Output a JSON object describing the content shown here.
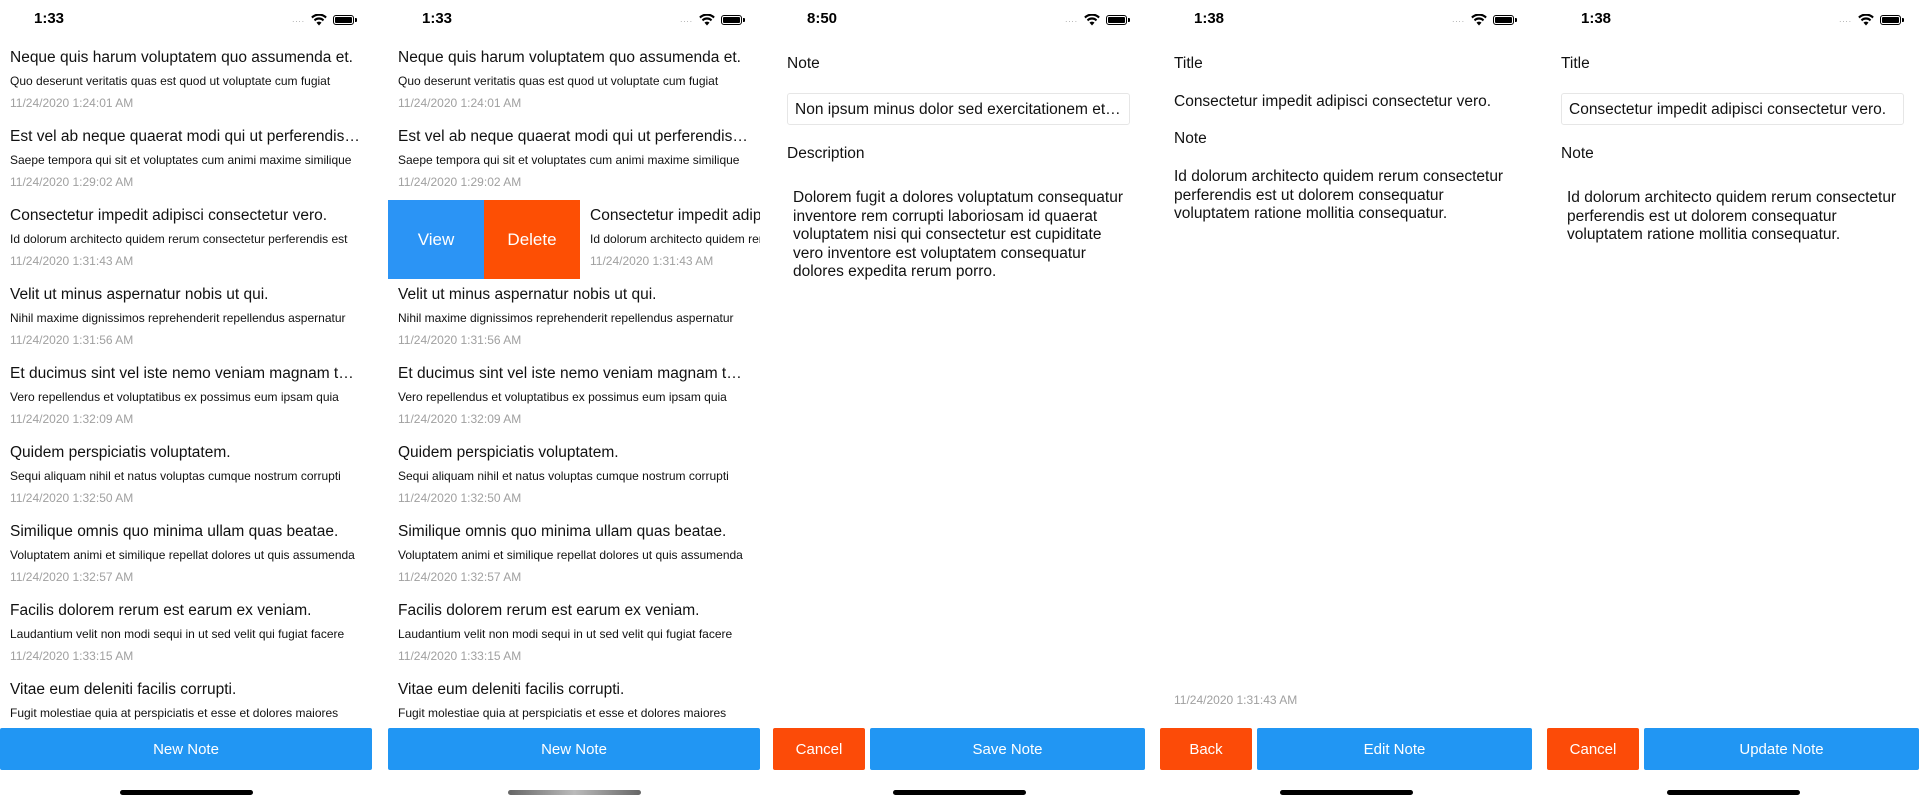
{
  "screens": [
    {
      "time": "1:33"
    },
    {
      "time": "1:33"
    },
    {
      "time": "8:50"
    },
    {
      "time": "1:38"
    },
    {
      "time": "1:38"
    }
  ],
  "notes": [
    {
      "title": "Neque quis harum voluptatem quo assumenda et.",
      "description": "Quo deserunt veritatis quas est quod ut voluptate cum fugiat",
      "timestamp": "11/24/2020 1:24:01 AM"
    },
    {
      "title": "Est vel ab neque quaerat modi qui ut perferendis illo.",
      "description": "Saepe tempora qui sit et voluptates cum animi maxime similique",
      "timestamp": "11/24/2020 1:29:02 AM"
    },
    {
      "title": "Consectetur impedit adipisci consectetur vero.",
      "description": "Id dolorum architecto quidem rerum consectetur perferendis est",
      "timestamp": "11/24/2020 1:31:43 AM"
    },
    {
      "title": "Velit ut minus aspernatur nobis ut qui.",
      "description": "Nihil maxime dignissimos reprehenderit repellendus aspernatur",
      "timestamp": "11/24/2020 1:31:56 AM"
    },
    {
      "title": "Et ducimus sint vel iste nemo veniam magnam tempore.",
      "description": "Vero repellendus et voluptatibus ex possimus eum ipsam quia",
      "timestamp": "11/24/2020 1:32:09 AM"
    },
    {
      "title": "Quidem perspiciatis voluptatem.",
      "description": "Sequi aliquam nihil et natus voluptas cumque nostrum corrupti",
      "timestamp": "11/24/2020 1:32:50 AM"
    },
    {
      "title": "Similique omnis quo minima ullam quas beatae.",
      "description": "Voluptatem animi et similique repellat dolores ut quis assumenda",
      "timestamp": "11/24/2020 1:32:57 AM"
    },
    {
      "title": "Facilis dolorem rerum est earum ex veniam.",
      "description": "Laudantium velit non modi sequi in ut sed velit qui fugiat facere",
      "timestamp": "11/24/2020 1:33:15 AM"
    },
    {
      "title": "Vitae eum deleniti facilis corrupti.",
      "description": "Fugit molestiae quia at perspiciatis et esse et dolores maiores",
      "timestamp": ""
    }
  ],
  "swipe_actions": {
    "view": "View",
    "delete": "Delete"
  },
  "buttons": {
    "new_note": "New Note",
    "cancel": "Cancel",
    "save_note": "Save Note",
    "back": "Back",
    "edit_note": "Edit Note",
    "update_note": "Update Note"
  },
  "new_note_form": {
    "note_label": "Note",
    "note_value": "Non ipsum minus dolor sed exercitationem et quibusdam.",
    "description_label": "Description",
    "description_value": "Dolorem fugit a dolores voluptatum consequatur inventore rem corrupti laboriosam id quaerat voluptatem nisi qui consectetur est cupiditate vero inventore est voluptatem consequatur dolores expedita rerum porro."
  },
  "detail_view": {
    "title_label": "Title",
    "title_value": "Consectetur impedit adipisci consectetur vero.",
    "note_label": "Note",
    "note_value": "Id dolorum architecto quidem rerum consectetur perferendis est ut dolorem consequatur voluptatem ratione mollitia consequatur.",
    "timestamp": "11/24/2020 1:31:43 AM"
  },
  "edit_form": {
    "title_label": "Title",
    "title_value": "Consectetur impedit adipisci consectetur vero.",
    "note_label": "Note",
    "note_value": "Id dolorum architecto quidem rerum consectetur perferendis est ut dolorem consequatur voluptatem ratione mollitia consequatur."
  },
  "colors": {
    "primary_blue": "#2196f3",
    "action_orange": "#fc4b08",
    "view_blue": "#2b94f5",
    "muted_grey": "#a0a0a0"
  }
}
